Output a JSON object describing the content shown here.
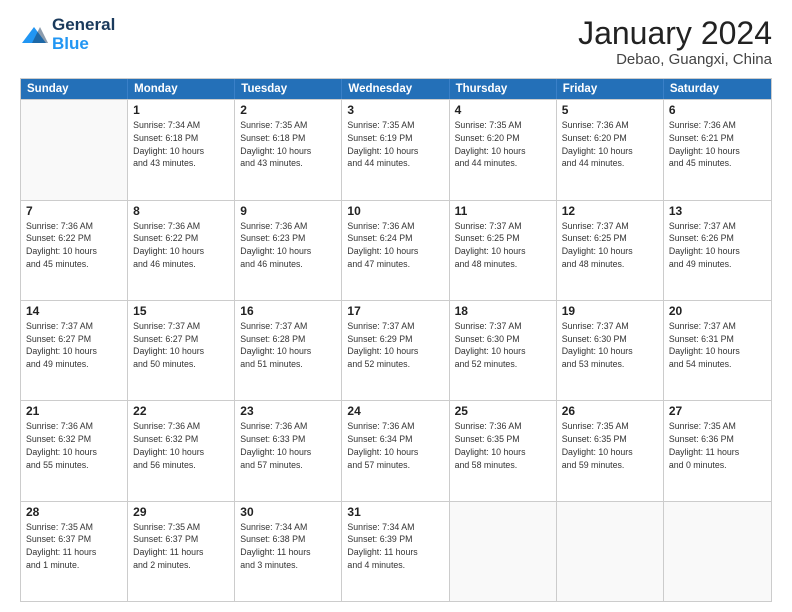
{
  "logo": {
    "text_general": "General",
    "text_blue": "Blue"
  },
  "title": "January 2024",
  "subtitle": "Debao, Guangxi, China",
  "days_header": [
    "Sunday",
    "Monday",
    "Tuesday",
    "Wednesday",
    "Thursday",
    "Friday",
    "Saturday"
  ],
  "weeks": [
    [
      {
        "day": "",
        "info": ""
      },
      {
        "day": "1",
        "info": "Sunrise: 7:34 AM\nSunset: 6:18 PM\nDaylight: 10 hours\nand 43 minutes."
      },
      {
        "day": "2",
        "info": "Sunrise: 7:35 AM\nSunset: 6:18 PM\nDaylight: 10 hours\nand 43 minutes."
      },
      {
        "day": "3",
        "info": "Sunrise: 7:35 AM\nSunset: 6:19 PM\nDaylight: 10 hours\nand 44 minutes."
      },
      {
        "day": "4",
        "info": "Sunrise: 7:35 AM\nSunset: 6:20 PM\nDaylight: 10 hours\nand 44 minutes."
      },
      {
        "day": "5",
        "info": "Sunrise: 7:36 AM\nSunset: 6:20 PM\nDaylight: 10 hours\nand 44 minutes."
      },
      {
        "day": "6",
        "info": "Sunrise: 7:36 AM\nSunset: 6:21 PM\nDaylight: 10 hours\nand 45 minutes."
      }
    ],
    [
      {
        "day": "7",
        "info": "Sunrise: 7:36 AM\nSunset: 6:22 PM\nDaylight: 10 hours\nand 45 minutes."
      },
      {
        "day": "8",
        "info": "Sunrise: 7:36 AM\nSunset: 6:22 PM\nDaylight: 10 hours\nand 46 minutes."
      },
      {
        "day": "9",
        "info": "Sunrise: 7:36 AM\nSunset: 6:23 PM\nDaylight: 10 hours\nand 46 minutes."
      },
      {
        "day": "10",
        "info": "Sunrise: 7:36 AM\nSunset: 6:24 PM\nDaylight: 10 hours\nand 47 minutes."
      },
      {
        "day": "11",
        "info": "Sunrise: 7:37 AM\nSunset: 6:25 PM\nDaylight: 10 hours\nand 48 minutes."
      },
      {
        "day": "12",
        "info": "Sunrise: 7:37 AM\nSunset: 6:25 PM\nDaylight: 10 hours\nand 48 minutes."
      },
      {
        "day": "13",
        "info": "Sunrise: 7:37 AM\nSunset: 6:26 PM\nDaylight: 10 hours\nand 49 minutes."
      }
    ],
    [
      {
        "day": "14",
        "info": "Sunrise: 7:37 AM\nSunset: 6:27 PM\nDaylight: 10 hours\nand 49 minutes."
      },
      {
        "day": "15",
        "info": "Sunrise: 7:37 AM\nSunset: 6:27 PM\nDaylight: 10 hours\nand 50 minutes."
      },
      {
        "day": "16",
        "info": "Sunrise: 7:37 AM\nSunset: 6:28 PM\nDaylight: 10 hours\nand 51 minutes."
      },
      {
        "day": "17",
        "info": "Sunrise: 7:37 AM\nSunset: 6:29 PM\nDaylight: 10 hours\nand 52 minutes."
      },
      {
        "day": "18",
        "info": "Sunrise: 7:37 AM\nSunset: 6:30 PM\nDaylight: 10 hours\nand 52 minutes."
      },
      {
        "day": "19",
        "info": "Sunrise: 7:37 AM\nSunset: 6:30 PM\nDaylight: 10 hours\nand 53 minutes."
      },
      {
        "day": "20",
        "info": "Sunrise: 7:37 AM\nSunset: 6:31 PM\nDaylight: 10 hours\nand 54 minutes."
      }
    ],
    [
      {
        "day": "21",
        "info": "Sunrise: 7:36 AM\nSunset: 6:32 PM\nDaylight: 10 hours\nand 55 minutes."
      },
      {
        "day": "22",
        "info": "Sunrise: 7:36 AM\nSunset: 6:32 PM\nDaylight: 10 hours\nand 56 minutes."
      },
      {
        "day": "23",
        "info": "Sunrise: 7:36 AM\nSunset: 6:33 PM\nDaylight: 10 hours\nand 57 minutes."
      },
      {
        "day": "24",
        "info": "Sunrise: 7:36 AM\nSunset: 6:34 PM\nDaylight: 10 hours\nand 57 minutes."
      },
      {
        "day": "25",
        "info": "Sunrise: 7:36 AM\nSunset: 6:35 PM\nDaylight: 10 hours\nand 58 minutes."
      },
      {
        "day": "26",
        "info": "Sunrise: 7:35 AM\nSunset: 6:35 PM\nDaylight: 10 hours\nand 59 minutes."
      },
      {
        "day": "27",
        "info": "Sunrise: 7:35 AM\nSunset: 6:36 PM\nDaylight: 11 hours\nand 0 minutes."
      }
    ],
    [
      {
        "day": "28",
        "info": "Sunrise: 7:35 AM\nSunset: 6:37 PM\nDaylight: 11 hours\nand 1 minute."
      },
      {
        "day": "29",
        "info": "Sunrise: 7:35 AM\nSunset: 6:37 PM\nDaylight: 11 hours\nand 2 minutes."
      },
      {
        "day": "30",
        "info": "Sunrise: 7:34 AM\nSunset: 6:38 PM\nDaylight: 11 hours\nand 3 minutes."
      },
      {
        "day": "31",
        "info": "Sunrise: 7:34 AM\nSunset: 6:39 PM\nDaylight: 11 hours\nand 4 minutes."
      },
      {
        "day": "",
        "info": ""
      },
      {
        "day": "",
        "info": ""
      },
      {
        "day": "",
        "info": ""
      }
    ]
  ]
}
